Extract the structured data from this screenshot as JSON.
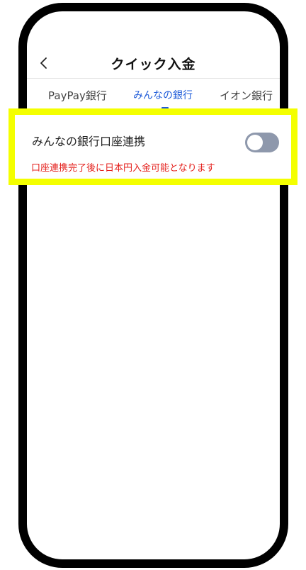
{
  "header": {
    "title": "クイック入金",
    "back_icon": "chevron-left-icon"
  },
  "tabs": [
    {
      "label": "PayPay銀行",
      "active": false
    },
    {
      "label": "みんなの銀行",
      "active": true
    },
    {
      "label": "イオン銀行",
      "active": false
    }
  ],
  "setting": {
    "label": "みんなの銀行口座連携",
    "toggle_state": "off",
    "note": "口座連携完了後に日本円入金可能となります"
  },
  "colors": {
    "accent": "#1e5bd8",
    "warning_text": "#e4201c",
    "highlight": "#f4ff00",
    "toggle_off": "#8e98ac"
  }
}
